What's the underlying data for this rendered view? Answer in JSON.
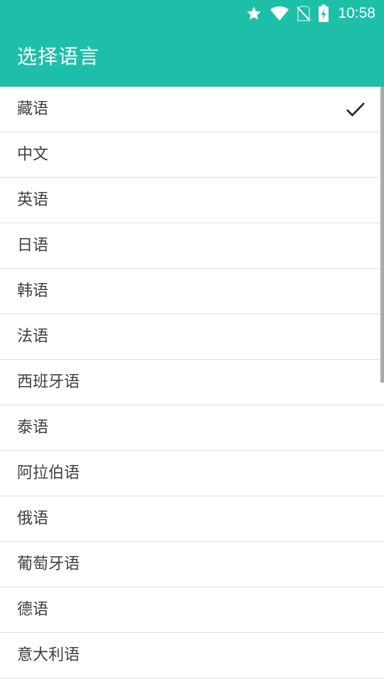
{
  "status_bar": {
    "time": "10:58",
    "icons": [
      "star-icon",
      "wifi-icon",
      "no-sim-icon",
      "battery-charging-icon"
    ]
  },
  "app_bar": {
    "title": "选择语言"
  },
  "languages": [
    {
      "label": "藏语",
      "selected": true
    },
    {
      "label": "中文",
      "selected": false
    },
    {
      "label": "英语",
      "selected": false
    },
    {
      "label": "日语",
      "selected": false
    },
    {
      "label": "韩语",
      "selected": false
    },
    {
      "label": "法语",
      "selected": false
    },
    {
      "label": "西班牙语",
      "selected": false
    },
    {
      "label": "泰语",
      "selected": false
    },
    {
      "label": "阿拉伯语",
      "selected": false
    },
    {
      "label": "俄语",
      "selected": false
    },
    {
      "label": "葡萄牙语",
      "selected": false
    },
    {
      "label": "德语",
      "selected": false
    },
    {
      "label": "意大利语",
      "selected": false
    }
  ],
  "colors": {
    "accent": "#1dbfa8",
    "text": "#404040",
    "divider": "#dedede"
  }
}
